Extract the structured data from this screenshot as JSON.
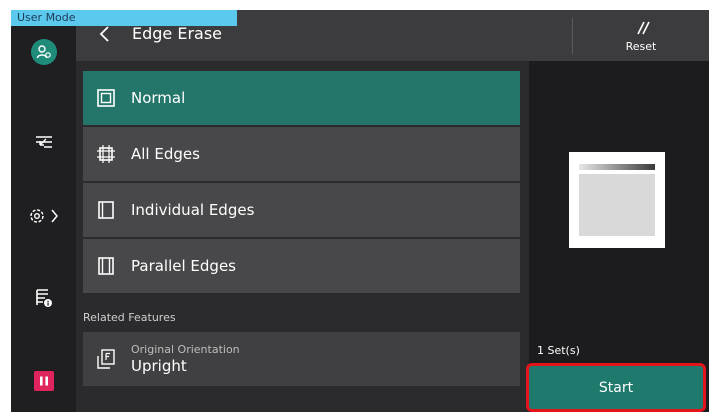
{
  "mode_tab": "User Mode",
  "header": {
    "title": "Edge Erase",
    "reset_label": "Reset"
  },
  "options": [
    {
      "label": "Normal",
      "icon": "normal-frame-icon",
      "selected": true
    },
    {
      "label": "All Edges",
      "icon": "all-edges-icon",
      "selected": false
    },
    {
      "label": "Individual Edges",
      "icon": "individual-edges-icon",
      "selected": false
    },
    {
      "label": "Parallel Edges",
      "icon": "parallel-edges-icon",
      "selected": false
    }
  ],
  "related": {
    "section_label": "Related Features",
    "item": {
      "label": "Original Orientation",
      "value": "Upright",
      "icon": "orientation-icon"
    }
  },
  "start": {
    "sets_label": "1 Set(s)",
    "label": "Start"
  },
  "colors": {
    "accent": "#25766a",
    "start": "#1f7a6d",
    "highlight_border": "#e4141c",
    "mode_tab": "#5bc8ee",
    "stop": "#e0245e"
  }
}
